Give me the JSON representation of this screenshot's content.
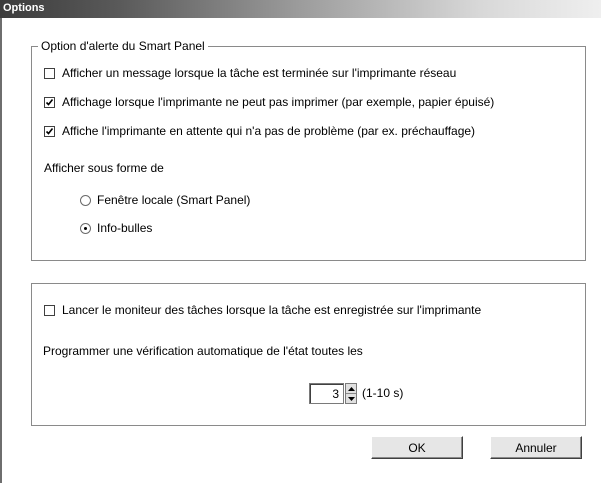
{
  "window": {
    "title": "Options"
  },
  "alert_group": {
    "legend": "Option d'alerte du Smart Panel",
    "checkboxes": [
      {
        "label": "Afficher un message lorsque la tâche est terminée sur l'imprimante réseau",
        "checked": false
      },
      {
        "label": "Affichage lorsque l'imprimante ne peut pas imprimer (par exemple, papier épuisé)",
        "checked": true
      },
      {
        "label": "Affiche l'imprimante en attente qui n'a pas de problème (par ex. préchauffage)",
        "checked": true
      }
    ],
    "display_as_label": "Afficher sous forme de",
    "radios": [
      {
        "label": "Fenêtre locale (Smart Panel)",
        "selected": false
      },
      {
        "label": "Info-bulles",
        "selected": true
      }
    ]
  },
  "monitor_group": {
    "checkbox": {
      "label": "Lancer le moniteur des tâches lorsque la tâche est enregistrée sur l'imprimante",
      "checked": false
    },
    "schedule_label": "Programmer une vérification automatique de l'état toutes les",
    "interval": {
      "value": "3",
      "range_label": "(1-10 s)"
    }
  },
  "buttons": {
    "ok": "OK",
    "cancel": "Annuler"
  }
}
